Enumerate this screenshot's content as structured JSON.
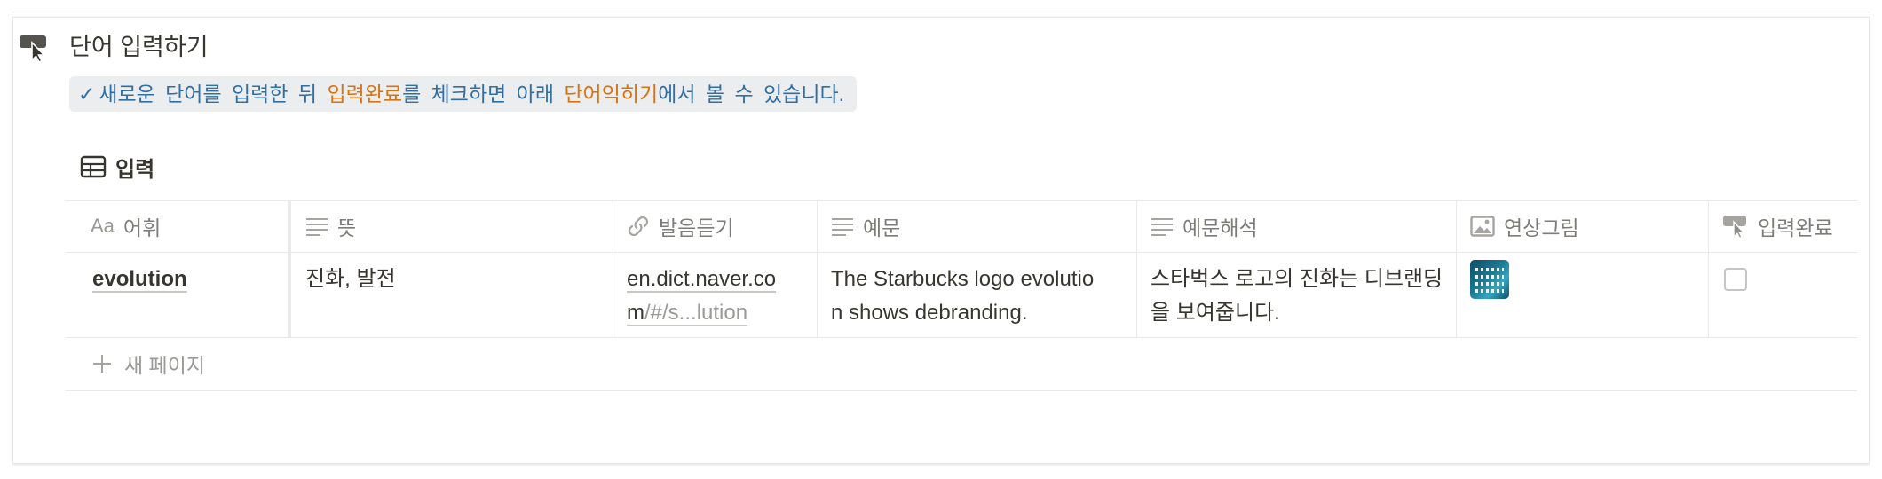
{
  "callout": {
    "icon": "cursor-hand-icon",
    "title": "단어 입력하기",
    "hint": {
      "check": "✓",
      "part1": "새로운 단어를 입력한 뒤 ",
      "highlight1": "입력완료",
      "part2": "를 체크하면 아래 ",
      "highlight2": "단어익히기",
      "part3": "에서 볼 수 있습니다."
    }
  },
  "database": {
    "icon": "table-icon",
    "title": "입력",
    "columns": [
      {
        "label": "어휘",
        "prefix": "Aa",
        "icon": "title-icon"
      },
      {
        "label": "뜻",
        "icon": "text-lines-icon"
      },
      {
        "label": "발음듣기",
        "icon": "link-icon"
      },
      {
        "label": "예문",
        "icon": "text-lines-icon"
      },
      {
        "label": "예문해석",
        "icon": "text-lines-icon"
      },
      {
        "label": "연상그림",
        "icon": "image-icon"
      },
      {
        "label": "입력완료",
        "icon": "cursor-hand-icon"
      }
    ],
    "rows": [
      {
        "word": "evolution",
        "meaning": "진화, 발전",
        "pronunciation_line1": "en.dict.naver.co",
        "pronunciation_line2_a": "m",
        "pronunciation_line2_b": "/#/s...lution",
        "example_line1": "The Starbucks logo evolutio",
        "example_line2": "n shows debranding.",
        "translation_line1": "스타벅스 로고의 진화는 디브랜딩",
        "translation_line2": "을 보여줍니다.",
        "image": "starbucks-logo-evolution-thumbnail",
        "completed": false
      }
    ],
    "new_page_label": "새 페이지"
  },
  "colors": {
    "hint_text": "#2f6fa4",
    "hint_highlight": "#d9730d",
    "hint_background": "#ecedef",
    "text": "#37352f",
    "muted": "#7d7c78"
  }
}
